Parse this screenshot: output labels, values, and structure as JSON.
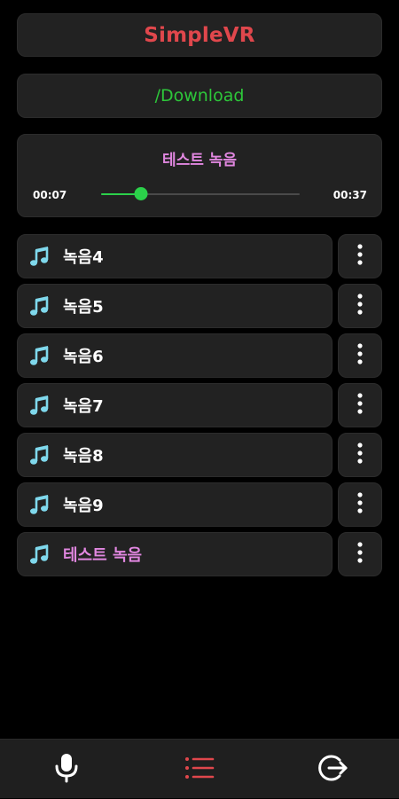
{
  "app": {
    "title": "SimpleVR",
    "title_color": "#e0474c"
  },
  "path": {
    "text": "/Download",
    "color": "#2dc73a"
  },
  "player": {
    "now_playing": "테스트 녹음",
    "now_playing_color": "#e187e0",
    "current_time": "00:07",
    "total_time": "00:37",
    "progress": 0.2,
    "accent": "#2bd14a"
  },
  "recordings": {
    "items": [
      {
        "label": "녹음4",
        "active": false
      },
      {
        "label": "녹음5",
        "active": false
      },
      {
        "label": "녹음6",
        "active": false
      },
      {
        "label": "녹음7",
        "active": false
      },
      {
        "label": "녹음8",
        "active": false
      },
      {
        "label": "녹음9",
        "active": false
      },
      {
        "label": "테스트 녹음",
        "active": true
      }
    ],
    "item_icon": "music-note-icon",
    "menu_icon": "more-vertical-icon",
    "icon_color": "#7fd8ec",
    "active_color": "#e187e0"
  },
  "nav": {
    "items": [
      {
        "name": "record",
        "icon": "microphone-icon",
        "color": "#ffffff"
      },
      {
        "name": "list",
        "icon": "list-icon",
        "color": "#e0474c"
      },
      {
        "name": "exit",
        "icon": "logout-icon",
        "color": "#ffffff"
      }
    ]
  }
}
